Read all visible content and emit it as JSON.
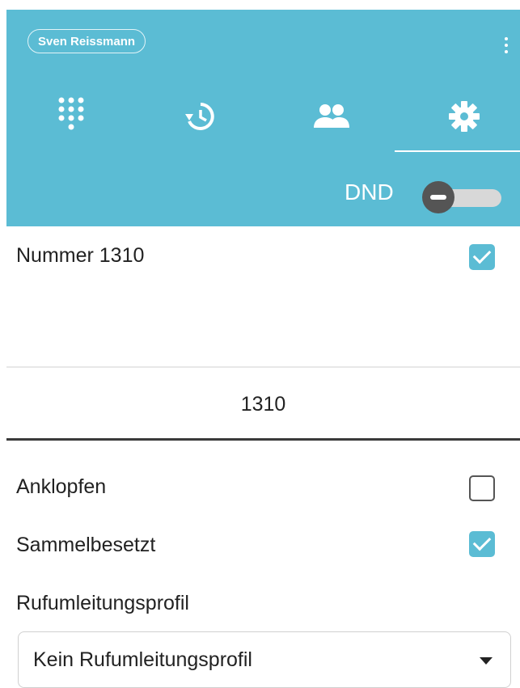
{
  "header": {
    "user_name": "Sven Reissmann",
    "tabs": [
      {
        "icon": "dialpad-icon"
      },
      {
        "icon": "history-icon"
      },
      {
        "icon": "contacts-icon"
      },
      {
        "icon": "settings-icon",
        "active": true
      }
    ],
    "dnd_label": "DND",
    "dnd_enabled": false,
    "accent_color": "#5bbcd4"
  },
  "settings": {
    "number_label": "Nummer 1310",
    "number_checked": true,
    "number_value": "1310",
    "call_waiting_label": "Anklopfen",
    "call_waiting_checked": false,
    "group_busy_label": "Sammelbesetzt",
    "group_busy_checked": true,
    "forwarding_profile_label": "Rufumleitungsprofil",
    "forwarding_profile_value": "Kein Rufumleitungsprofil"
  }
}
